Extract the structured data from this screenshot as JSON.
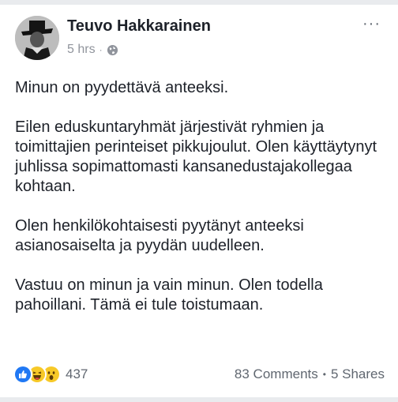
{
  "post": {
    "author": "Teuvo Hakkarainen",
    "time": "5 hrs",
    "separator": "·",
    "privacy_icon": "globe-icon",
    "paragraphs": [
      "Minun on pyydettävä anteeksi.",
      "Eilen eduskuntaryhmät järjestivät ryhmien ja toimittajien perinteiset pikkujoulut. Olen käyttäytynyt juhlissa sopimattomasti kansanedustajakollegaa kohtaan.",
      "Olen henkilökohtaisesti pyytänyt anteeksi asianosaiselta ja pyydän uudelleen.",
      "Vastuu on minun ja vain minun. Olen todella pahoillani. Tämä ei tule toistumaan."
    ]
  },
  "footer": {
    "reaction_icons": [
      "like-icon",
      "haha-icon",
      "wow-icon"
    ],
    "reaction_count": "437",
    "comments": "83 Comments",
    "separator": "•",
    "shares": "5 Shares"
  },
  "colors": {
    "like": "#2078f4",
    "emoji": "#f7c928",
    "text": "#1d2129",
    "meta": "#90949c"
  }
}
